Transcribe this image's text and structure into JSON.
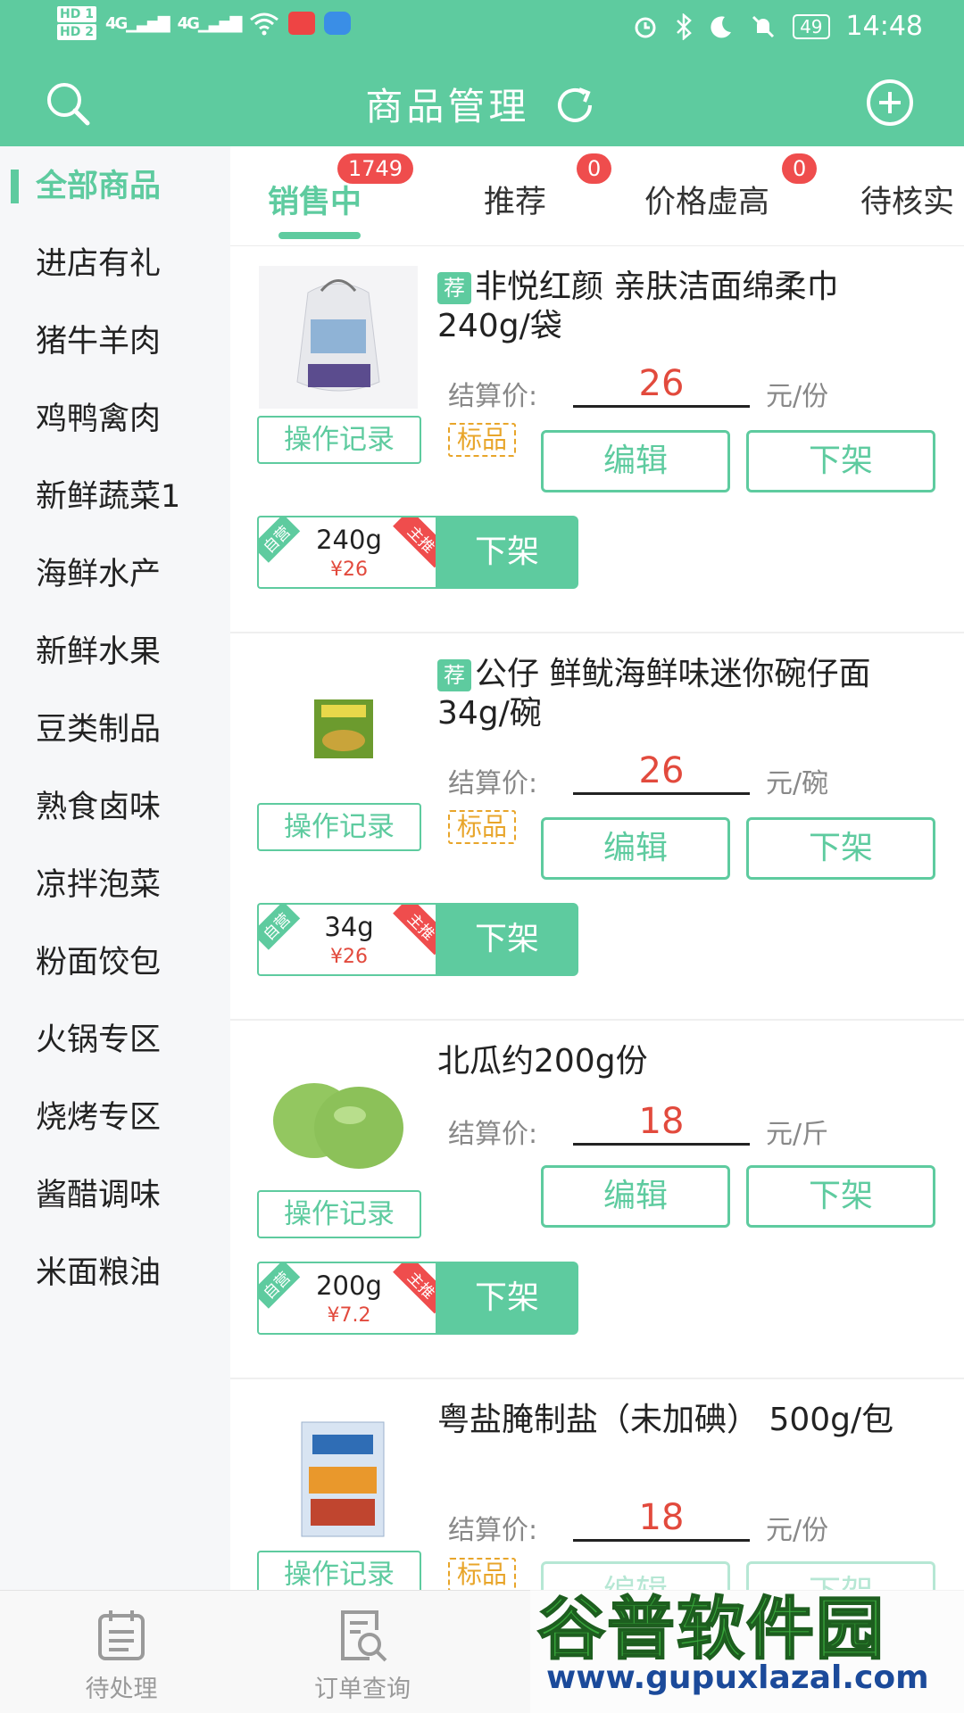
{
  "status_bar": {
    "hd1": "HD 1",
    "hd2": "HD 2",
    "signal1": "4G",
    "signal2": "4G",
    "battery": "49",
    "time": "14:48"
  },
  "header": {
    "title": "商品管理",
    "accent_color": "#5ecb9f"
  },
  "sidebar": {
    "items": [
      "全部商品",
      "进店有礼",
      "猪牛羊肉",
      "鸡鸭禽肉",
      "新鲜蔬菜1",
      "海鲜水产",
      "新鲜水果",
      "豆类制品",
      "熟食卤味",
      "凉拌泡菜",
      "粉面饺包",
      "火锅专区",
      "烧烤专区",
      "酱醋调味",
      "米面粮油"
    ],
    "active_index": 0
  },
  "tabs": [
    {
      "label": "销售中",
      "count": "1749"
    },
    {
      "label": "推荐",
      "count": "0"
    },
    {
      "label": "价格虚高",
      "count": "0"
    },
    {
      "label": "待核实"
    }
  ],
  "common": {
    "recommend_tag": "荐",
    "price_label": "结算价:",
    "log_button": "操作记录",
    "standard_tag": "标品",
    "edit_button": "编辑",
    "offshelf_button": "下架",
    "self_tag": "自营",
    "main_tag": "主推"
  },
  "products": [
    {
      "name": "非悦红颜 亲肤洁面绵柔巾 240g/袋",
      "recommended": true,
      "price": "26",
      "unit": "元/份",
      "standard": true,
      "spec_weight": "240g",
      "spec_price": "¥26"
    },
    {
      "name": "公仔 鲜鱿海鲜味迷你碗仔面 34g/碗",
      "recommended": true,
      "price": "26",
      "unit": "元/碗",
      "standard": true,
      "spec_weight": "34g",
      "spec_price": "¥26"
    },
    {
      "name": "北瓜约200g份",
      "recommended": false,
      "price": "18",
      "unit": "元/斤",
      "standard": false,
      "spec_weight": "200g",
      "spec_price": "¥7.2"
    },
    {
      "name": "粤盐腌制盐（未加碘） 500g/包",
      "recommended": false,
      "price": "18",
      "unit": "元/份",
      "standard": true
    }
  ],
  "bottom_nav": [
    {
      "label": "待处理",
      "icon": "clipboard-icon"
    },
    {
      "label": "订单查询",
      "icon": "order-search-icon"
    }
  ],
  "watermark": {
    "brand": "谷普软件园",
    "url": "www.gupuxlazal.com"
  }
}
